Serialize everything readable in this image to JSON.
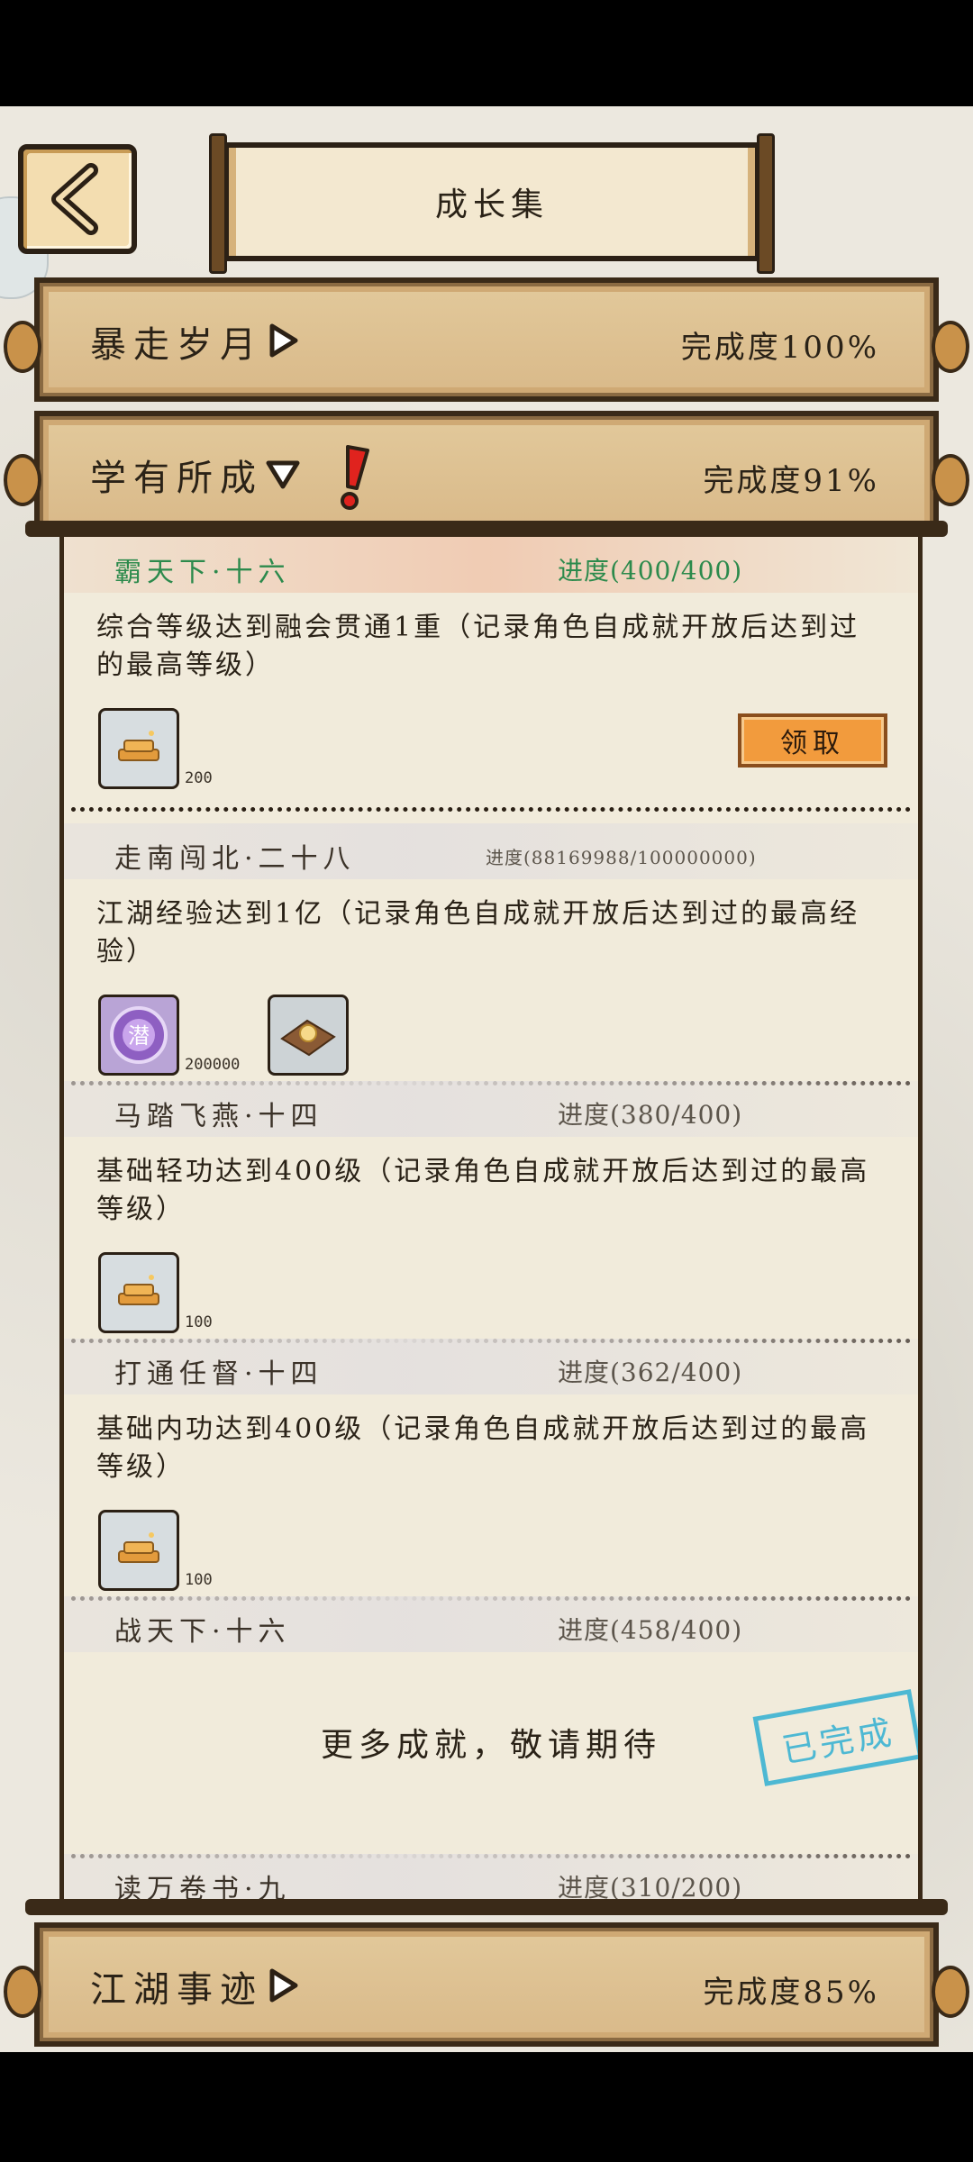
{
  "header": {
    "title": "成长集"
  },
  "categories": [
    {
      "name": "暴走岁月",
      "completion": "完成度100%",
      "expanded": false
    },
    {
      "name": "学有所成",
      "completion": "完成度91%",
      "expanded": true
    },
    {
      "name": "江湖事迹",
      "completion": "完成度85%",
      "expanded": false
    }
  ],
  "items": [
    {
      "title": "霸天下·十六",
      "progress": "进度(400/400)",
      "desc": "综合等级达到融会贯通1重（记录角色自成就开放后达到过的最高等级）",
      "rewards": [
        {
          "icon": "gold-bars-icon",
          "count": "200"
        }
      ],
      "claim_label": "领取"
    },
    {
      "title": "走南闯北·二十八",
      "progress": "进度(88169988/100000000)",
      "desc": "江湖经验达到1亿（记录角色自成就开放后达到过的最高经验）",
      "rewards": [
        {
          "icon": "purple-orb-icon",
          "count": "200000",
          "glyph": "潜"
        },
        {
          "icon": "pill-bundle-icon",
          "count": ""
        }
      ]
    },
    {
      "title": "马踏飞燕·十四",
      "progress": "进度(380/400)",
      "desc": "基础轻功达到400级（记录角色自成就开放后达到过的最高等级）",
      "rewards": [
        {
          "icon": "gold-bars-icon",
          "count": "100"
        }
      ]
    },
    {
      "title": "打通任督·十四",
      "progress": "进度(362/400)",
      "desc": "基础内功达到400级（记录角色自成就开放后达到过的最高等级）",
      "rewards": [
        {
          "icon": "gold-bars-icon",
          "count": "100"
        }
      ]
    },
    {
      "title": "战天下·十六",
      "progress": "进度(458/400)",
      "more": "更多成就，敬请期待",
      "stamp": "已完成"
    },
    {
      "title": "读万卷书·九",
      "progress": "进度(310/200)"
    }
  ]
}
